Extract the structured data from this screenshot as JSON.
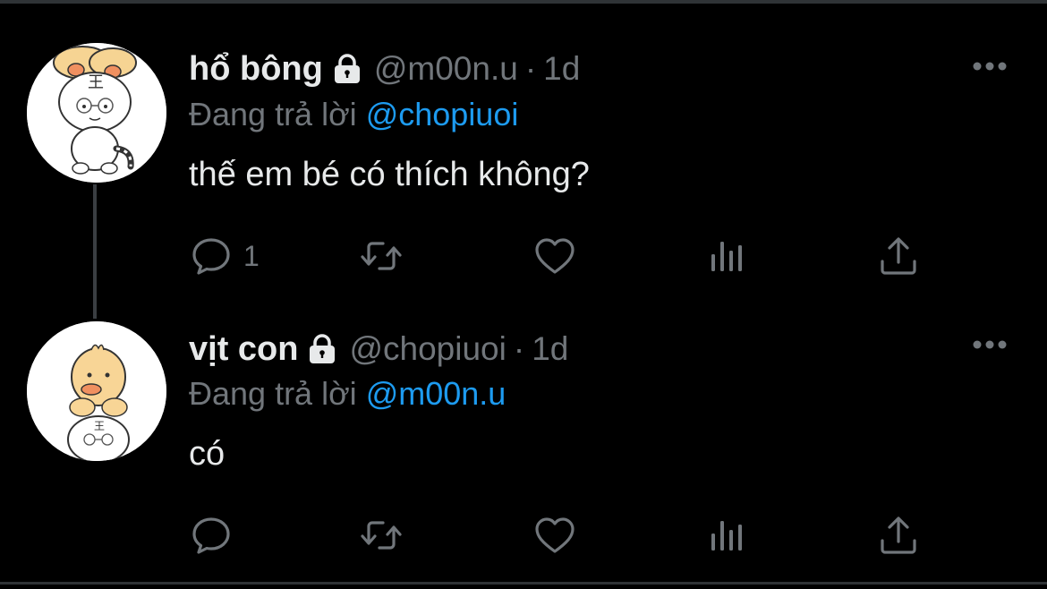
{
  "colors": {
    "background": "#000000",
    "text": "#e7e9ea",
    "muted": "#71767b",
    "accent": "#1d9bf0",
    "divider": "#2f3336"
  },
  "tweets": [
    {
      "display_name": "hổ bông",
      "protected_icon": "lock-icon",
      "handle": "@m00n.u",
      "separator": "·",
      "time": "1d",
      "replying_prefix": "Đang trả lời",
      "replying_to": "@chopiuoi",
      "text": "thế em bé có thích không?",
      "reply_count": "1",
      "avatar": "tiger-cartoon-avatar"
    },
    {
      "display_name": "vịt con",
      "protected_icon": "lock-icon",
      "handle": "@chopiuoi",
      "separator": "·",
      "time": "1d",
      "replying_prefix": "Đang trả lời",
      "replying_to": "@m00n.u",
      "text": "có",
      "reply_count": "",
      "avatar": "duck-cartoon-avatar"
    }
  ],
  "action_icons": [
    "reply-icon",
    "retweet-icon",
    "like-icon",
    "views-icon",
    "share-icon"
  ]
}
